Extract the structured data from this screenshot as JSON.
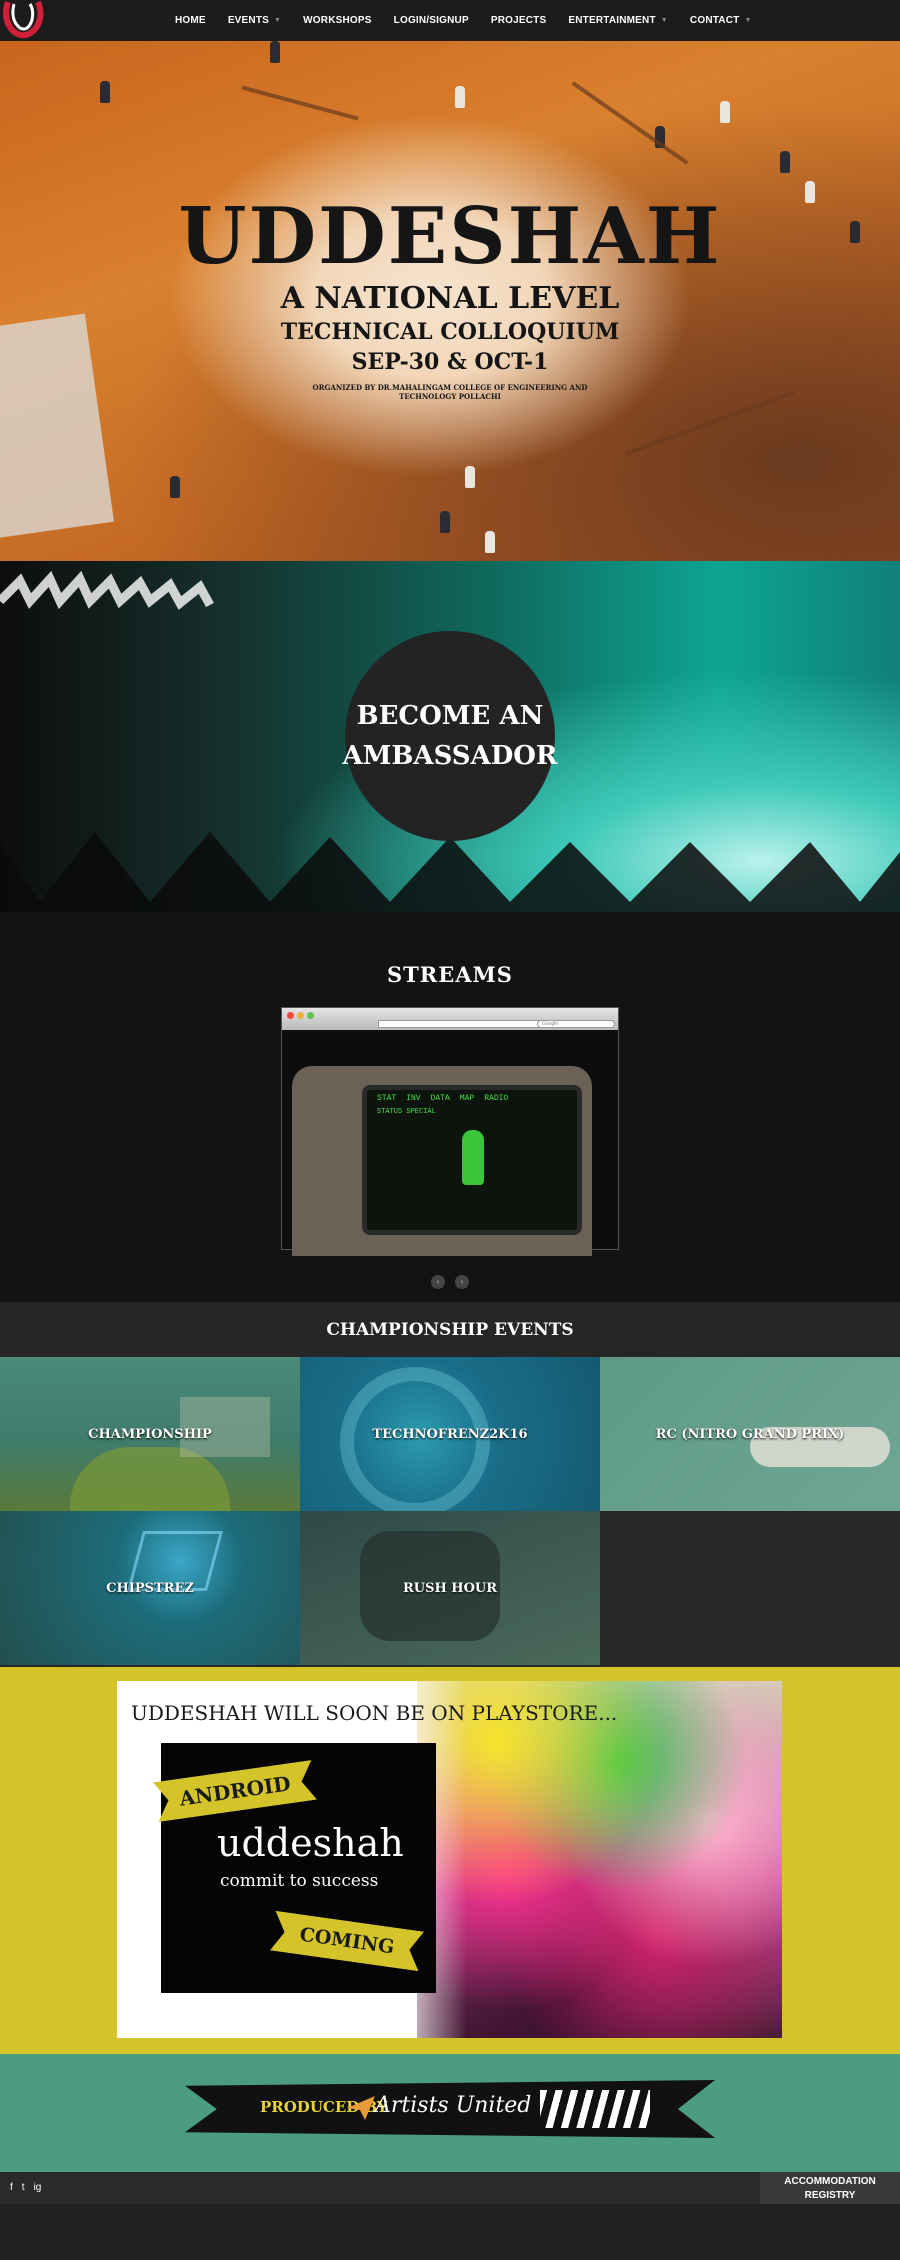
{
  "nav": {
    "items": [
      {
        "label": "HOME",
        "has_dropdown": false
      },
      {
        "label": "EVENTS",
        "has_dropdown": true
      },
      {
        "label": "WORKSHOPS",
        "has_dropdown": false
      },
      {
        "label": "LOGIN/SIGNUP",
        "has_dropdown": false
      },
      {
        "label": "PROJECTS",
        "has_dropdown": false
      },
      {
        "label": "ENTERTAINMENT",
        "has_dropdown": true
      },
      {
        "label": "CONTACT",
        "has_dropdown": true
      }
    ],
    "caret": "▼"
  },
  "hero": {
    "title": "UDDESHAH",
    "line1": "A NATIONAL LEVEL",
    "line2": "TECHNICAL COLLOQUIUM",
    "line3": "SEP-30 & OCT-1",
    "organizer": "ORGANIZED BY DR.MAHALINGAM COLLEGE OF ENGINEERING AND TECHNOLOGY POLLACHI"
  },
  "ambassador": {
    "line1": "BECOME AN",
    "line2": "AMBASSADOR"
  },
  "streams": {
    "title": "STREAMS",
    "pipboy_tabs": [
      "STAT",
      "INV",
      "DATA",
      "MAP",
      "RADIO"
    ],
    "pipboy_status": "STATUS  SPECIAL",
    "search_placeholder": "Google",
    "prev": "‹",
    "next": "›"
  },
  "championship": {
    "title": "CHAMPIONSHIP EVENTS",
    "tiles": [
      {
        "label": "CHAMPIONSHIP"
      },
      {
        "label": "TECHNOFRENZ2K16"
      },
      {
        "label": "RC (NITRO GRAND PRIX)"
      },
      {
        "label": "CHIPSTREZ"
      },
      {
        "label": "RUSH HOUR"
      }
    ]
  },
  "playstore": {
    "caption": "UDDESHAH WILL SOON BE ON PLAYSTORE...",
    "ribbon1": "ANDROID APP",
    "app_name": "uddeshah",
    "tagline": "commit to success",
    "ribbon2": "COMING SOON"
  },
  "produced": {
    "label": "PRODUCED BY",
    "name": "Artists United"
  },
  "footer": {
    "social": [
      "f",
      "t",
      "ig"
    ],
    "accommodation": "ACCOMMODATION",
    "registry": "REGISTRY"
  }
}
